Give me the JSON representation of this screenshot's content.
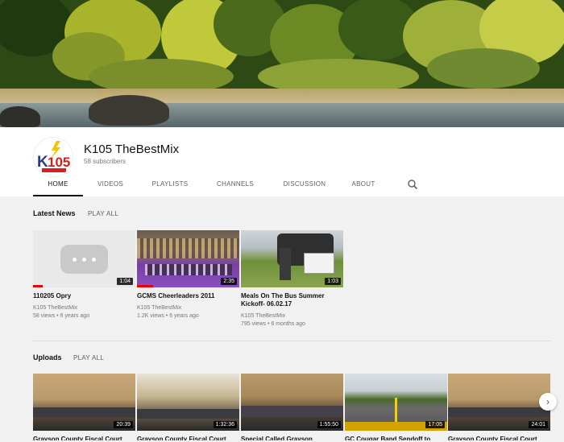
{
  "channel": {
    "name": "K105 TheBestMix",
    "subscribers": "58 subscribers",
    "avatar_logo": "K105 THE BEST MIX"
  },
  "tabs": [
    {
      "label": "HOME",
      "active": true
    },
    {
      "label": "VIDEOS"
    },
    {
      "label": "PLAYLISTS"
    },
    {
      "label": "CHANNELS"
    },
    {
      "label": "DISCUSSION"
    },
    {
      "label": "ABOUT"
    }
  ],
  "icons": {
    "search": "search-icon",
    "next": "chevron-right-icon"
  },
  "latest": {
    "title": "Latest News",
    "play_all": "PLAY ALL",
    "videos": [
      {
        "title": "110205 Opry",
        "channel": "K105 TheBestMix",
        "meta": "58 views • 6 years ago",
        "duration": "1:04"
      },
      {
        "title": "GCMS Cheerleaders 2011",
        "channel": "K105 TheBestMix",
        "meta": "1.2K views • 6 years ago",
        "duration": "2:35"
      },
      {
        "title": "Meals On The Bus Summer Kickoff- 06.02.17",
        "channel": "K105 TheBestMix",
        "meta": "795 views • 6 months ago",
        "duration": "1:03"
      }
    ]
  },
  "uploads": {
    "title": "Uploads",
    "play_all": "PLAY ALL",
    "videos": [
      {
        "title": "Grayson County Fiscal Court",
        "duration": "20:39"
      },
      {
        "title": "Grayson County Fiscal Court",
        "duration": "1:32:36"
      },
      {
        "title": "Special Called Grayson",
        "duration": "1:55:50"
      },
      {
        "title": "GC Cougar Band Sendoff to",
        "duration": "17:05"
      },
      {
        "title": "Grayson County Fiscal Court",
        "duration": "24:01"
      }
    ]
  },
  "colors": {
    "accent": "#ff0000",
    "logo_blue": "#2a3a8f",
    "logo_red": "#d62020"
  }
}
